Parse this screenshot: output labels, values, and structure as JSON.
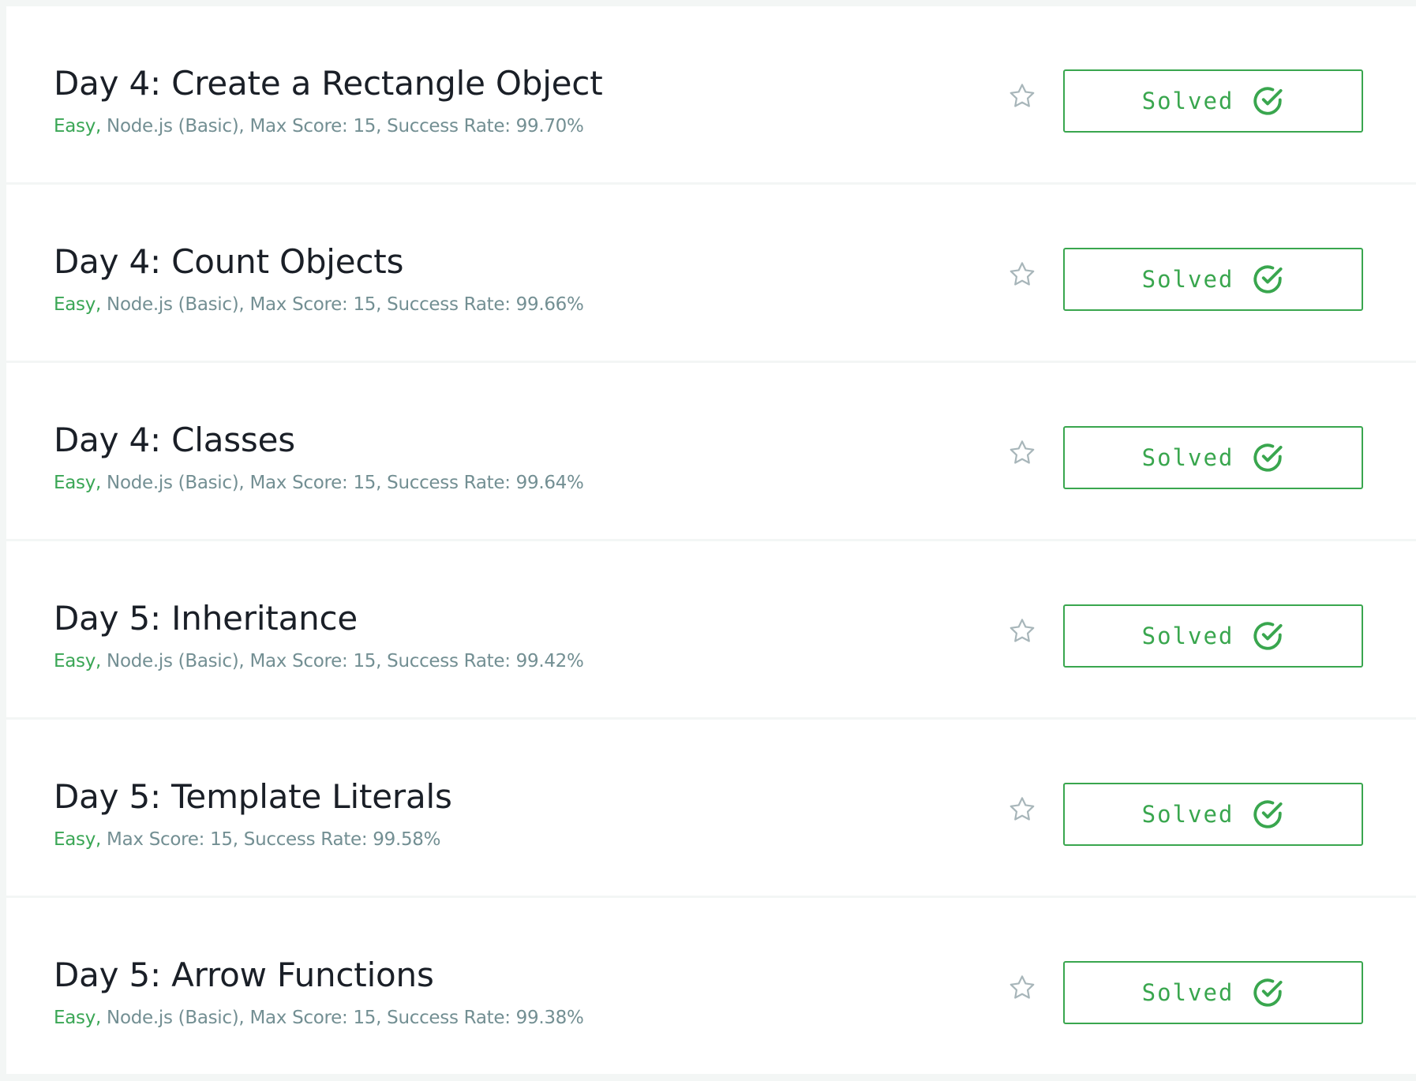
{
  "challenges": [
    {
      "title": "Day 4: Create a Rectangle Object",
      "difficulty": "Easy,",
      "details": " Node.js (Basic), Max Score: 15, Success Rate: 99.70%",
      "status_label": "Solved"
    },
    {
      "title": "Day 4: Count Objects",
      "difficulty": "Easy,",
      "details": " Node.js (Basic), Max Score: 15, Success Rate: 99.66%",
      "status_label": "Solved"
    },
    {
      "title": "Day 4: Classes",
      "difficulty": "Easy,",
      "details": " Node.js (Basic), Max Score: 15, Success Rate: 99.64%",
      "status_label": "Solved"
    },
    {
      "title": "Day 5: Inheritance",
      "difficulty": "Easy,",
      "details": " Node.js (Basic), Max Score: 15, Success Rate: 99.42%",
      "status_label": "Solved"
    },
    {
      "title": "Day 5: Template Literals",
      "difficulty": "Easy,",
      "details": " Max Score: 15, Success Rate: 99.58%",
      "status_label": "Solved"
    },
    {
      "title": "Day 5: Arrow Functions",
      "difficulty": "Easy,",
      "details": " Node.js (Basic), Max Score: 15, Success Rate: 99.38%",
      "status_label": "Solved"
    }
  ],
  "icons": {
    "bookmark": "star-outline-icon",
    "status": "check-circle-icon"
  },
  "colors": {
    "solved_green": "#39a64e",
    "difficulty_easy": "#3aa655",
    "meta_gray": "#738f93",
    "title_dark": "#1a1f27",
    "page_background": "#f3f6f5"
  }
}
